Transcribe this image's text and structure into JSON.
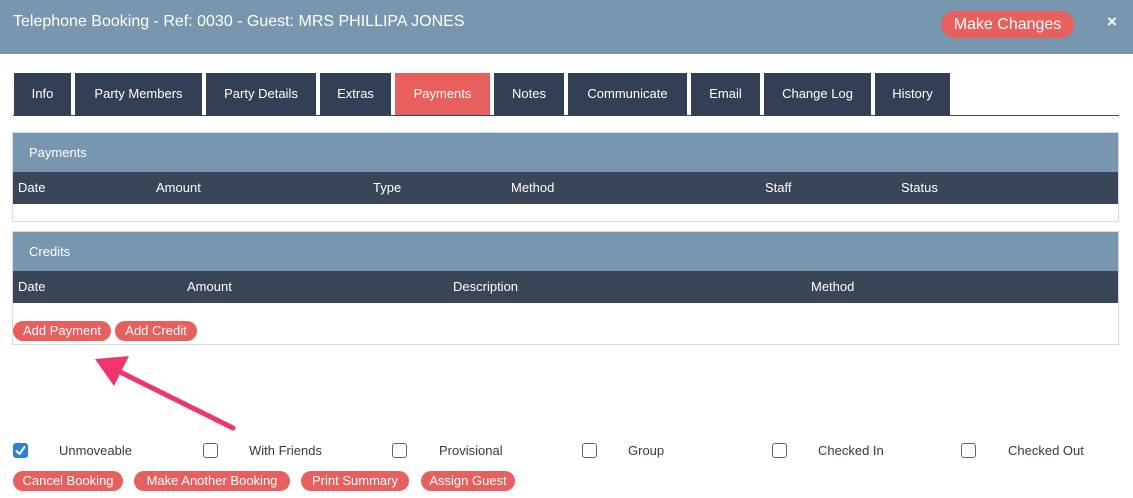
{
  "header": {
    "title": "Telephone Booking - Ref: 0030 - Guest: MRS PHILLIPA JONES",
    "make_changes_label": "Make Changes",
    "close_icon": "×"
  },
  "tabs": [
    {
      "label": "Info",
      "active": false
    },
    {
      "label": "Party Members",
      "active": false
    },
    {
      "label": "Party Details",
      "active": false
    },
    {
      "label": "Extras",
      "active": false
    },
    {
      "label": "Payments",
      "active": true
    },
    {
      "label": "Notes",
      "active": false
    },
    {
      "label": "Communicate",
      "active": false
    },
    {
      "label": "Email",
      "active": false
    },
    {
      "label": "Change Log",
      "active": false
    },
    {
      "label": "History",
      "active": false
    }
  ],
  "payments_panel": {
    "title": "Payments",
    "columns": [
      "Date",
      "Amount",
      "Type",
      "Method",
      "Staff",
      "Status"
    ],
    "rows": []
  },
  "credits_panel": {
    "title": "Credits",
    "columns": [
      "Date",
      "Amount",
      "Description",
      "Method"
    ],
    "rows": [],
    "add_payment_label": "Add Payment",
    "add_credit_label": "Add Credit"
  },
  "flags": [
    {
      "label": "Unmoveable",
      "checked": true
    },
    {
      "label": "With Friends",
      "checked": false
    },
    {
      "label": "Provisional",
      "checked": false
    },
    {
      "label": "Group",
      "checked": false
    },
    {
      "label": "Checked In",
      "checked": false
    },
    {
      "label": "Checked Out",
      "checked": false
    }
  ],
  "actions": {
    "cancel_booking_label": "Cancel Booking",
    "make_another_booking_label": "Make Another Booking",
    "print_summary_label": "Print Summary",
    "assign_guest_label": "Assign Guest"
  },
  "colors": {
    "header_bg": "#7896ae",
    "tab_bg": "#323f55",
    "accent": "#e8605d",
    "table_head_bg": "#3a4558",
    "checkbox_checked": "#2f7ed8",
    "annotation_arrow": "#f0356d"
  }
}
